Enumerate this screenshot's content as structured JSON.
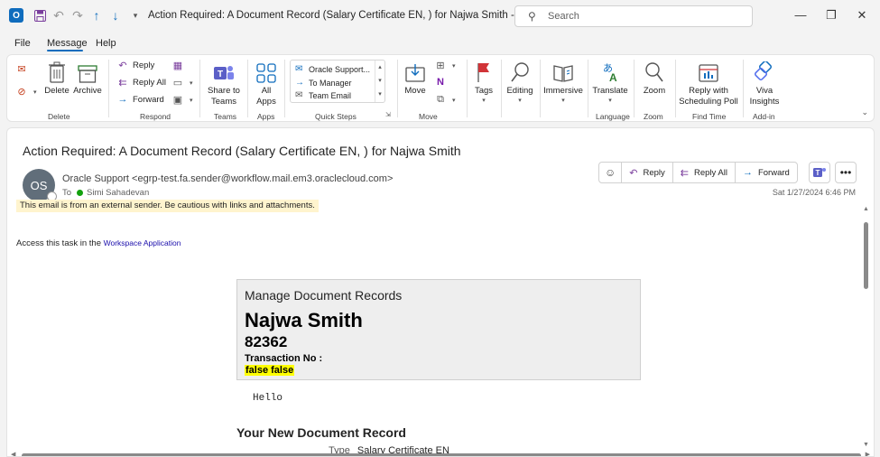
{
  "window": {
    "title": "Action Required: A Document Record (Salary Certificate EN, ) for Najwa Smith  -  Message (HT...",
    "search_placeholder": "Search"
  },
  "quick_access": [
    "save-icon",
    "undo-icon",
    "redo-icon",
    "up-arrow-icon",
    "down-arrow-icon",
    "customize-icon"
  ],
  "menu": {
    "file": "File",
    "message": "Message",
    "help": "Help"
  },
  "ribbon": {
    "groups": {
      "delete": "Delete",
      "respond": "Respond",
      "teams": "Teams",
      "apps": "Apps",
      "quick_steps": "Quick Steps",
      "move": "Move",
      "language": "Language",
      "zoom": "Zoom",
      "find_time": "Find Time",
      "add_in": "Add-in"
    },
    "delete_label": "Delete",
    "archive_label": "Archive",
    "reply_label": "Reply",
    "reply_all_label": "Reply All",
    "forward_label": "Forward",
    "share_teams_label": "Share to\nTeams",
    "all_apps_label": "All\nApps",
    "quick_steps": [
      "Oracle Support...",
      "To Manager",
      "Team Email"
    ],
    "move_label": "Move",
    "tags_label": "Tags",
    "editing_label": "Editing",
    "immersive_label": "Immersive",
    "translate_label": "Translate",
    "zoom_label": "Zoom",
    "reply_poll_label": "Reply with\nScheduling Poll",
    "viva_label": "Viva\nInsights"
  },
  "message": {
    "subject": "Action Required: A Document Record (Salary Certificate EN, ) for Najwa Smith",
    "avatar_initials": "OS",
    "sender": "Oracle Support <egrp-test.fa.sender@workflow.mail.em3.oraclecloud.com>",
    "to_label": "To",
    "recipient": "Simi Sahadevan",
    "date": "Sat 1/27/2024 6:46 PM",
    "actions": {
      "reply": "Reply",
      "reply_all": "Reply All",
      "forward": "Forward"
    },
    "warning": "This email is from an external sender. Be cautious with links and attachments.",
    "access_text": "Access this task in the ",
    "access_link": "Workspace Application",
    "card": {
      "heading": "Manage Document Records",
      "name": "Najwa Smith",
      "number": "82362",
      "transaction_label": "Transaction No :",
      "transaction_value": "false false"
    },
    "hello": "Hello",
    "new_doc_heading": "Your New Document Record",
    "type_label": "Type",
    "type_value": "Salary Certificate EN"
  }
}
